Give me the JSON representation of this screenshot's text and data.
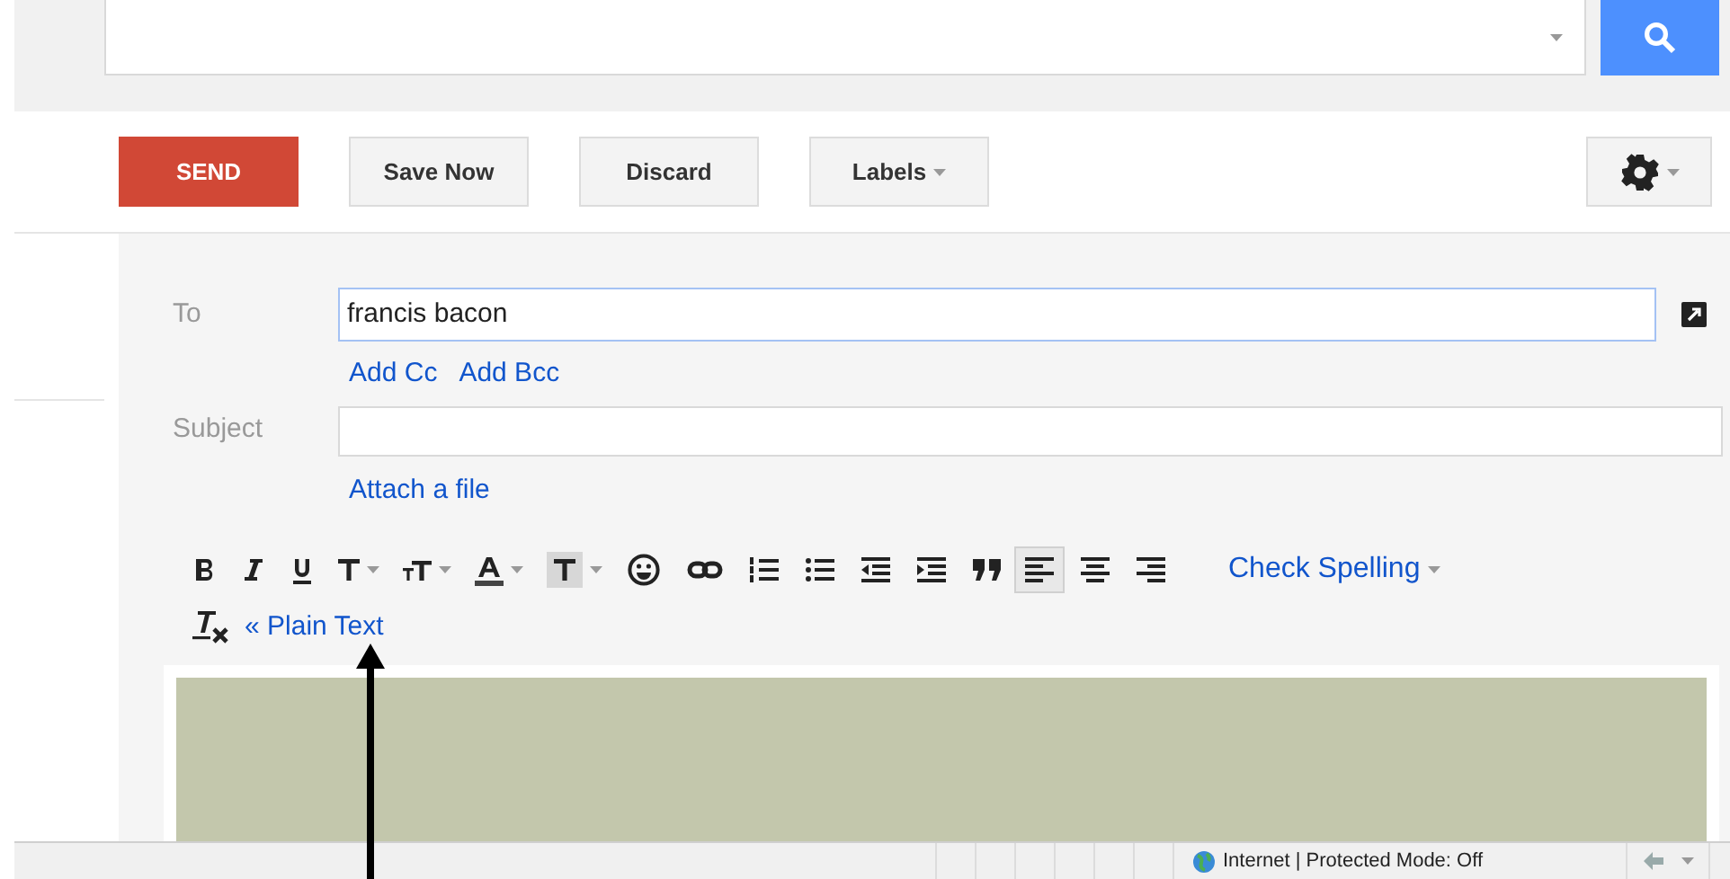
{
  "actions": [
    {
      "kind": "primary",
      "label": "SEND"
    },
    {
      "kind": "plain",
      "label": "Save Now"
    },
    {
      "kind": "plain",
      "label": "Discard"
    },
    {
      "kind": "menu",
      "label": "Labels"
    }
  ],
  "compose": {
    "to_label": "To",
    "to_value": "francis bacon",
    "add_cc": "Add Cc",
    "add_bcc": "Add Bcc",
    "subject_label": "Subject",
    "attach": "Attach a file"
  },
  "toolbar": [
    {
      "kind": "bold",
      "selected": false
    },
    {
      "kind": "italic",
      "selected": false
    },
    {
      "kind": "underline",
      "selected": false
    },
    {
      "kind": "font",
      "selected": false
    },
    {
      "kind": "size",
      "selected": false
    },
    {
      "kind": "color",
      "selected": false
    },
    {
      "kind": "highlight",
      "selected": false
    },
    {
      "kind": "emoji",
      "selected": false
    },
    {
      "kind": "link",
      "selected": false
    },
    {
      "kind": "numbered",
      "selected": false
    },
    {
      "kind": "bullets",
      "selected": false
    },
    {
      "kind": "outdent",
      "selected": false
    },
    {
      "kind": "indent",
      "selected": false
    },
    {
      "kind": "quote",
      "selected": false
    },
    {
      "kind": "align-left",
      "selected": true
    },
    {
      "kind": "align-center",
      "selected": false
    },
    {
      "kind": "align-right",
      "selected": false
    }
  ],
  "check_spelling": "Check Spelling",
  "plain_text": "« Plain Text",
  "status_bar": {
    "zone": "Internet | Protected Mode: Off"
  }
}
